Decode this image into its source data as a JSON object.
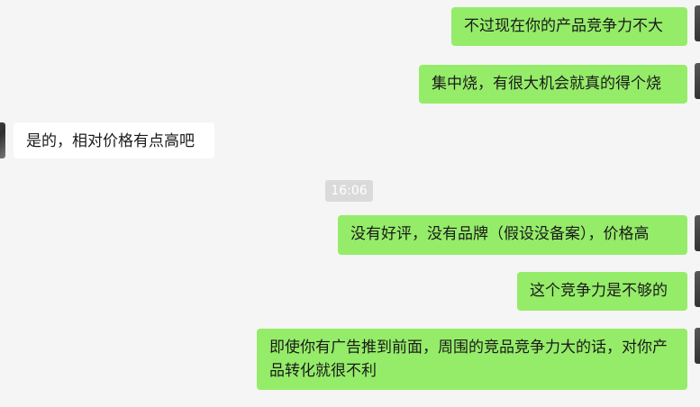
{
  "chat": {
    "messages": [
      {
        "side": "out",
        "text": "不过现在你的产品竞争力不大"
      },
      {
        "side": "out",
        "text": "集中烧，有很大机会就真的得个烧"
      },
      {
        "side": "in",
        "text": "是的，相对价格有点高吧"
      },
      {
        "side": "out",
        "text": "没有好评，没有品牌（假设没备案），价格高"
      },
      {
        "side": "out",
        "text": "这个竞争力是不够的"
      },
      {
        "side": "out",
        "text": "即使你有广告推到前面，周围的竞品竞争力大的话，对你产品转化就很不利"
      }
    ],
    "timestamp": "16:06"
  },
  "colors": {
    "background": "#f5f5f5",
    "outgoing_bubble": "#95ec69",
    "incoming_bubble": "#ffffff",
    "timestamp_bg": "#dadada"
  },
  "icons": [
    "avatar"
  ]
}
